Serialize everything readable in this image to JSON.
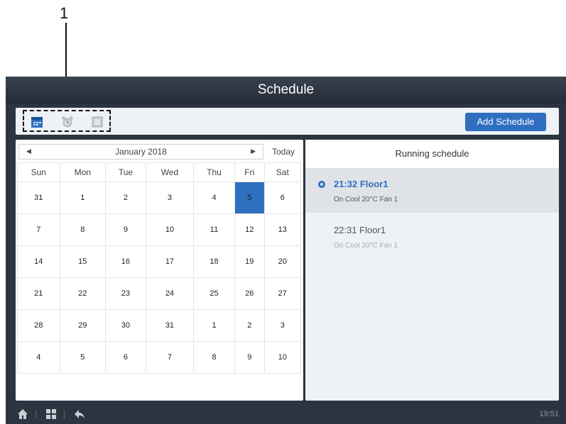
{
  "callout": {
    "label": "1"
  },
  "window": {
    "title": "Schedule"
  },
  "toolbar": {
    "icons": [
      "calendar-icon",
      "alarm-clock-icon",
      "list-icon"
    ],
    "add_button": "Add Schedule"
  },
  "calendar": {
    "month_label": "January 2018",
    "today_label": "Today",
    "weekdays": [
      "Sun",
      "Mon",
      "Tue",
      "Wed",
      "Thu",
      "Fri",
      "Sat"
    ],
    "rows": [
      [
        "31",
        "1",
        "2",
        "3",
        "4",
        "5",
        "6"
      ],
      [
        "7",
        "8",
        "9",
        "10",
        "11",
        "12",
        "13"
      ],
      [
        "14",
        "15",
        "16",
        "17",
        "18",
        "19",
        "20"
      ],
      [
        "21",
        "22",
        "23",
        "24",
        "25",
        "26",
        "27"
      ],
      [
        "28",
        "29",
        "30",
        "31",
        "1",
        "2",
        "3"
      ],
      [
        "4",
        "5",
        "6",
        "7",
        "8",
        "9",
        "10"
      ]
    ],
    "selected_day": "5"
  },
  "running": {
    "header": "Running schedule",
    "entries": [
      {
        "time": "21:32 Floor1",
        "detail": "On Cool 20°C Fan 1",
        "active": true
      },
      {
        "time": "22:31 Floor1",
        "detail": "On Cool 20°C Fan 1",
        "active": false
      }
    ]
  },
  "bottom": {
    "icons": [
      "home-icon",
      "grid-icon",
      "back-icon"
    ],
    "clock": "19:51"
  },
  "colors": {
    "accent": "#2f6fc0",
    "titlebar": "#2c3440"
  }
}
